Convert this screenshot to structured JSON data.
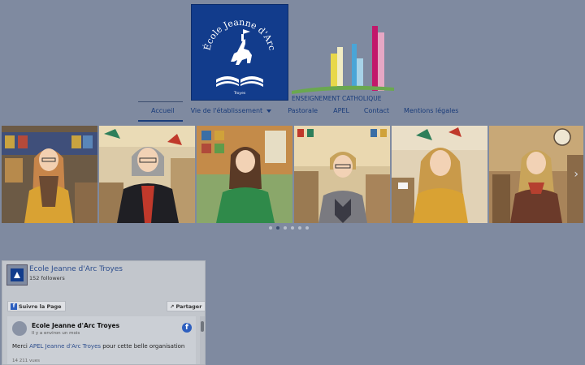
{
  "logo": {
    "school_text": "École Jeanne d'Arc",
    "city": "Troyes",
    "catholic_text": "ENSEIGNEMENT CATHOLIQUE"
  },
  "nav": {
    "items": [
      {
        "label": "Accueil"
      },
      {
        "label": "Vie de l'établissement"
      },
      {
        "label": "Pastorale"
      },
      {
        "label": "APEL"
      },
      {
        "label": "Contact"
      },
      {
        "label": "Mentions légales"
      }
    ]
  },
  "carousel": {
    "arrow": "›",
    "active_slide": 2,
    "slide_count": 6
  },
  "facebook": {
    "page_name": "Ecole Jeanne d'Arc Troyes",
    "followers": "152 followers",
    "follow_label": "Suivre la Page",
    "share_label": "Partager",
    "post": {
      "author": "Ecole Jeanne d'Arc Troyes",
      "time": "Il y a environ un mois",
      "text_before": "Merci ",
      "link": "APEL Jeanne d'Arc Troyes",
      "text_after": " pour cette belle organisation",
      "views": "14 211 vues"
    }
  }
}
